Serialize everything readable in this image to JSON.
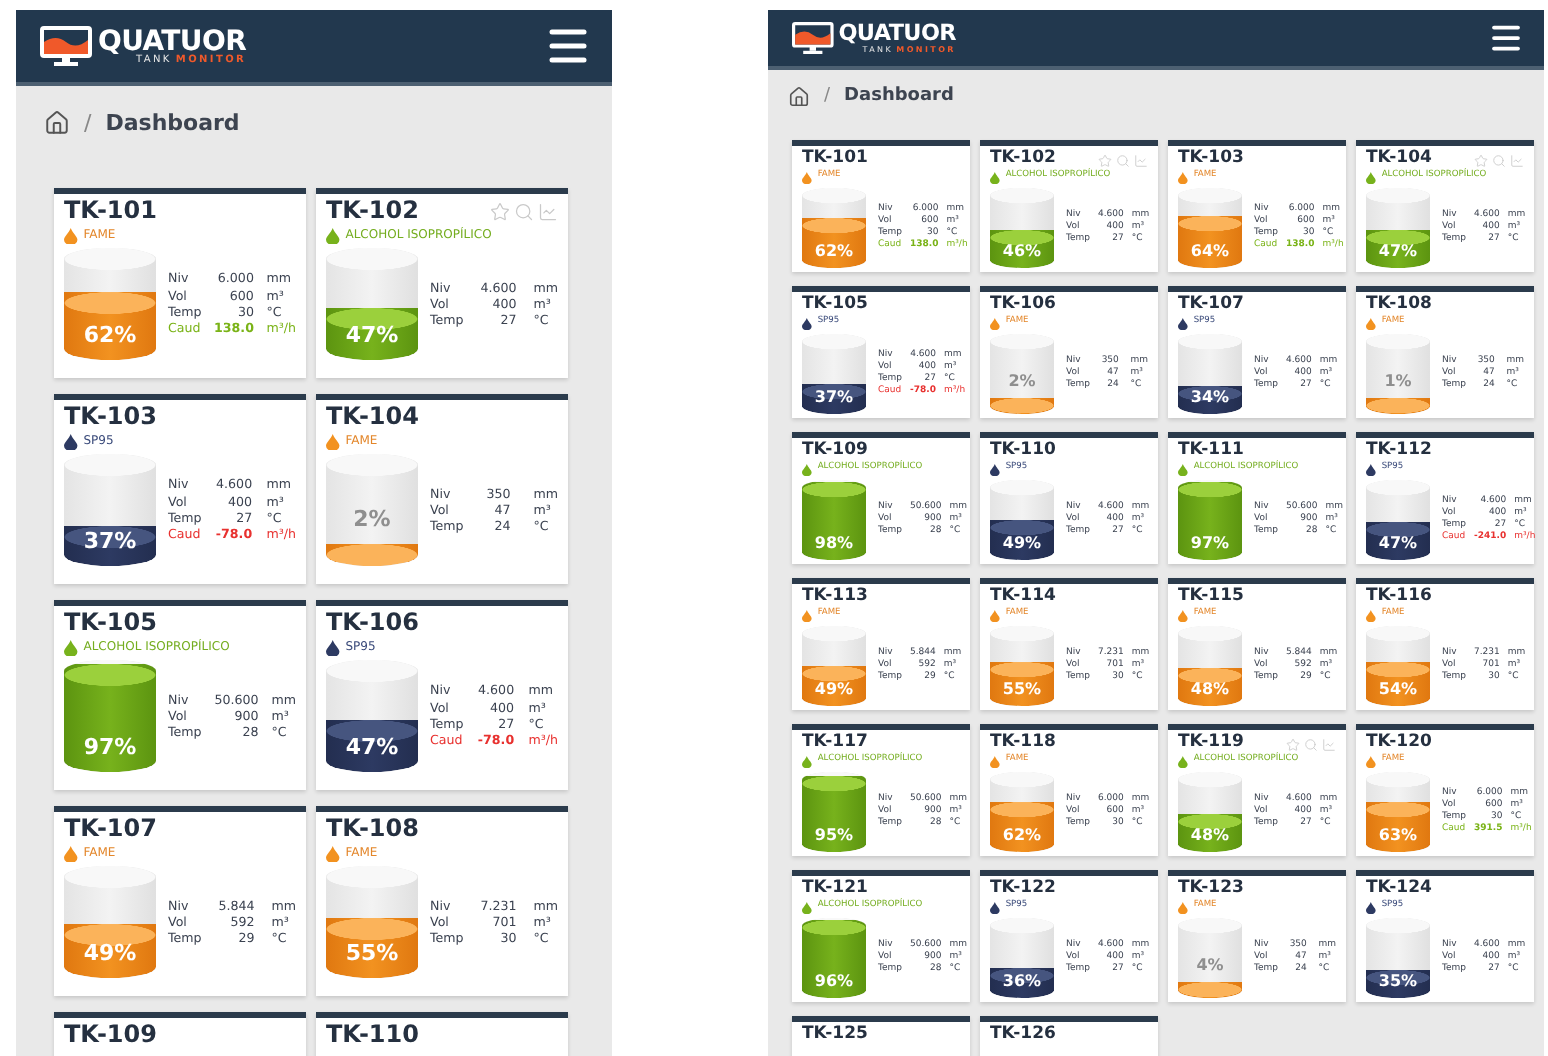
{
  "screens": [
    {
      "brand": {
        "name": "QUATUOR",
        "tagline_1": "TANK",
        "tagline_2": "MONITOR"
      },
      "breadcrumb": {
        "separator": "/",
        "current": "Dashboard"
      },
      "tanks": [
        {
          "name": "TK-101",
          "actions_shown": false,
          "product": {
            "kind": "fame",
            "label": "FAME"
          },
          "level": 0.62,
          "percent": "62%",
          "readings": [
            {
              "label": "Niv",
              "value": "6.000",
              "unit": "mm",
              "kind": "normal"
            },
            {
              "label": "Vol",
              "value": "600",
              "unit": "m³",
              "kind": "normal"
            },
            {
              "label": "Temp",
              "value": "30",
              "unit": "°C",
              "kind": "normal"
            },
            {
              "label": "Caud",
              "value": "138.0",
              "unit": "m³/h",
              "kind": "positive"
            }
          ]
        },
        {
          "name": "TK-102",
          "actions_shown": true,
          "product": {
            "kind": "alcohol",
            "label": "ALCOHOL ISOPROPÍLICO"
          },
          "level": 0.47,
          "percent": "47%",
          "readings": [
            {
              "label": "Niv",
              "value": "4.600",
              "unit": "mm",
              "kind": "normal"
            },
            {
              "label": "Vol",
              "value": "400",
              "unit": "m³",
              "kind": "normal"
            },
            {
              "label": "Temp",
              "value": "27",
              "unit": "°C",
              "kind": "normal"
            }
          ]
        },
        {
          "name": "TK-103",
          "actions_shown": false,
          "product": {
            "kind": "sp95",
            "label": "SP95"
          },
          "level": 0.37,
          "percent": "37%",
          "readings": [
            {
              "label": "Niv",
              "value": "4.600",
              "unit": "mm",
              "kind": "normal"
            },
            {
              "label": "Vol",
              "value": "400",
              "unit": "m³",
              "kind": "normal"
            },
            {
              "label": "Temp",
              "value": "27",
              "unit": "°C",
              "kind": "normal"
            },
            {
              "label": "Caud",
              "value": "-78.0",
              "unit": "m³/h",
              "kind": "negative"
            }
          ]
        },
        {
          "name": "TK-104",
          "actions_shown": false,
          "product": {
            "kind": "fame",
            "label": "FAME"
          },
          "level": 0.02,
          "percent": "2%",
          "readings": [
            {
              "label": "Niv",
              "value": "350",
              "unit": "mm",
              "kind": "normal"
            },
            {
              "label": "Vol",
              "value": "47",
              "unit": "m³",
              "kind": "normal"
            },
            {
              "label": "Temp",
              "value": "24",
              "unit": "°C",
              "kind": "normal"
            }
          ]
        },
        {
          "name": "TK-105",
          "actions_shown": false,
          "product": {
            "kind": "alcohol",
            "label": "ALCOHOL ISOPROPÍLICO"
          },
          "level": 0.97,
          "percent": "97%",
          "readings": [
            {
              "label": "Niv",
              "value": "50.600",
              "unit": "mm",
              "kind": "normal"
            },
            {
              "label": "Vol",
              "value": "900",
              "unit": "m³",
              "kind": "normal"
            },
            {
              "label": "Temp",
              "value": "28",
              "unit": "°C",
              "kind": "normal"
            }
          ]
        },
        {
          "name": "TK-106",
          "actions_shown": false,
          "product": {
            "kind": "sp95",
            "label": "SP95"
          },
          "level": 0.47,
          "percent": "47%",
          "readings": [
            {
              "label": "Niv",
              "value": "4.600",
              "unit": "mm",
              "kind": "normal"
            },
            {
              "label": "Vol",
              "value": "400",
              "unit": "m³",
              "kind": "normal"
            },
            {
              "label": "Temp",
              "value": "27",
              "unit": "°C",
              "kind": "normal"
            },
            {
              "label": "Caud",
              "value": "-78.0",
              "unit": "m³/h",
              "kind": "negative"
            }
          ]
        },
        {
          "name": "TK-107",
          "actions_shown": false,
          "product": {
            "kind": "fame",
            "label": "FAME"
          },
          "level": 0.49,
          "percent": "49%",
          "readings": [
            {
              "label": "Niv",
              "value": "5.844",
              "unit": "mm",
              "kind": "normal"
            },
            {
              "label": "Vol",
              "value": "592",
              "unit": "m³",
              "kind": "normal"
            },
            {
              "label": "Temp",
              "value": "29",
              "unit": "°C",
              "kind": "normal"
            }
          ]
        },
        {
          "name": "TK-108",
          "actions_shown": false,
          "product": {
            "kind": "fame",
            "label": "FAME"
          },
          "level": 0.55,
          "percent": "55%",
          "readings": [
            {
              "label": "Niv",
              "value": "7.231",
              "unit": "mm",
              "kind": "normal"
            },
            {
              "label": "Vol",
              "value": "701",
              "unit": "m³",
              "kind": "normal"
            },
            {
              "label": "Temp",
              "value": "30",
              "unit": "°C",
              "kind": "normal"
            }
          ]
        },
        {
          "name": "TK-109",
          "actions_shown": false
        },
        {
          "name": "TK-110",
          "actions_shown": false
        }
      ]
    },
    {
      "brand": {
        "name": "QUATUOR",
        "tagline_1": "TANK",
        "tagline_2": "MONITOR"
      },
      "breadcrumb": {
        "separator": "/",
        "current": "Dashboard"
      },
      "tanks": [
        {
          "name": "TK-101",
          "actions_shown": false,
          "product": {
            "kind": "fame",
            "label": "FAME"
          },
          "level": 0.62,
          "percent": "62%",
          "readings": [
            {
              "label": "Niv",
              "value": "6.000",
              "unit": "mm",
              "kind": "normal"
            },
            {
              "label": "Vol",
              "value": "600",
              "unit": "m³",
              "kind": "normal"
            },
            {
              "label": "Temp",
              "value": "30",
              "unit": "°C",
              "kind": "normal"
            },
            {
              "label": "Caud",
              "value": "138.0",
              "unit": "m³/h",
              "kind": "positive"
            }
          ]
        },
        {
          "name": "TK-102",
          "actions_shown": true,
          "product": {
            "kind": "alcohol",
            "label": "ALCOHOL ISOPROPÍLICO"
          },
          "level": 0.46,
          "percent": "46%",
          "readings": [
            {
              "label": "Niv",
              "value": "4.600",
              "unit": "mm",
              "kind": "normal"
            },
            {
              "label": "Vol",
              "value": "400",
              "unit": "m³",
              "kind": "normal"
            },
            {
              "label": "Temp",
              "value": "27",
              "unit": "°C",
              "kind": "normal"
            }
          ]
        },
        {
          "name": "TK-103",
          "actions_shown": false,
          "product": {
            "kind": "fame",
            "label": "FAME"
          },
          "level": 0.64,
          "percent": "64%",
          "readings": [
            {
              "label": "Niv",
              "value": "6.000",
              "unit": "mm",
              "kind": "normal"
            },
            {
              "label": "Vol",
              "value": "600",
              "unit": "m³",
              "kind": "normal"
            },
            {
              "label": "Temp",
              "value": "30",
              "unit": "°C",
              "kind": "normal"
            },
            {
              "label": "Caud",
              "value": "138.0",
              "unit": "m³/h",
              "kind": "positive"
            }
          ]
        },
        {
          "name": "TK-104",
          "actions_shown": true,
          "product": {
            "kind": "alcohol",
            "label": "ALCOHOL ISOPROPÍLICO"
          },
          "level": 0.47,
          "percent": "47%",
          "readings": [
            {
              "label": "Niv",
              "value": "4.600",
              "unit": "mm",
              "kind": "normal"
            },
            {
              "label": "Vol",
              "value": "400",
              "unit": "m³",
              "kind": "normal"
            },
            {
              "label": "Temp",
              "value": "27",
              "unit": "°C",
              "kind": "normal"
            }
          ]
        },
        {
          "name": "TK-105",
          "actions_shown": false,
          "product": {
            "kind": "sp95",
            "label": "SP95"
          },
          "level": 0.37,
          "percent": "37%",
          "readings": [
            {
              "label": "Niv",
              "value": "4.600",
              "unit": "mm",
              "kind": "normal"
            },
            {
              "label": "Vol",
              "value": "400",
              "unit": "m³",
              "kind": "normal"
            },
            {
              "label": "Temp",
              "value": "27",
              "unit": "°C",
              "kind": "normal"
            },
            {
              "label": "Caud",
              "value": "-78.0",
              "unit": "m³/h",
              "kind": "negative"
            }
          ]
        },
        {
          "name": "TK-106",
          "actions_shown": false,
          "product": {
            "kind": "fame",
            "label": "FAME"
          },
          "level": 0.02,
          "percent": "2%",
          "readings": [
            {
              "label": "Niv",
              "value": "350",
              "unit": "mm",
              "kind": "normal"
            },
            {
              "label": "Vol",
              "value": "47",
              "unit": "m³",
              "kind": "normal"
            },
            {
              "label": "Temp",
              "value": "24",
              "unit": "°C",
              "kind": "normal"
            }
          ]
        },
        {
          "name": "TK-107",
          "actions_shown": false,
          "product": {
            "kind": "sp95",
            "label": "SP95"
          },
          "level": 0.34,
          "percent": "34%",
          "readings": [
            {
              "label": "Niv",
              "value": "4.600",
              "unit": "mm",
              "kind": "normal"
            },
            {
              "label": "Vol",
              "value": "400",
              "unit": "m³",
              "kind": "normal"
            },
            {
              "label": "Temp",
              "value": "27",
              "unit": "°C",
              "kind": "normal"
            }
          ]
        },
        {
          "name": "TK-108",
          "actions_shown": false,
          "product": {
            "kind": "fame",
            "label": "FAME"
          },
          "level": 0.01,
          "percent": "1%",
          "readings": [
            {
              "label": "Niv",
              "value": "350",
              "unit": "mm",
              "kind": "normal"
            },
            {
              "label": "Vol",
              "value": "47",
              "unit": "m³",
              "kind": "normal"
            },
            {
              "label": "Temp",
              "value": "24",
              "unit": "°C",
              "kind": "normal"
            }
          ]
        },
        {
          "name": "TK-109",
          "actions_shown": false,
          "product": {
            "kind": "alcohol",
            "label": "ALCOHOL ISOPROPÍLICO"
          },
          "level": 0.98,
          "percent": "98%",
          "readings": [
            {
              "label": "Niv",
              "value": "50.600",
              "unit": "mm",
              "kind": "normal"
            },
            {
              "label": "Vol",
              "value": "900",
              "unit": "m³",
              "kind": "normal"
            },
            {
              "label": "Temp",
              "value": "28",
              "unit": "°C",
              "kind": "normal"
            }
          ]
        },
        {
          "name": "TK-110",
          "actions_shown": false,
          "product": {
            "kind": "sp95",
            "label": "SP95"
          },
          "level": 0.49,
          "percent": "49%",
          "readings": [
            {
              "label": "Niv",
              "value": "4.600",
              "unit": "mm",
              "kind": "normal"
            },
            {
              "label": "Vol",
              "value": "400",
              "unit": "m³",
              "kind": "normal"
            },
            {
              "label": "Temp",
              "value": "27",
              "unit": "°C",
              "kind": "normal"
            }
          ]
        },
        {
          "name": "TK-111",
          "actions_shown": false,
          "product": {
            "kind": "alcohol",
            "label": "ALCOHOL ISOPROPÍLICO"
          },
          "level": 0.97,
          "percent": "97%",
          "readings": [
            {
              "label": "Niv",
              "value": "50.600",
              "unit": "mm",
              "kind": "normal"
            },
            {
              "label": "Vol",
              "value": "900",
              "unit": "m³",
              "kind": "normal"
            },
            {
              "label": "Temp",
              "value": "28",
              "unit": "°C",
              "kind": "normal"
            }
          ]
        },
        {
          "name": "TK-112",
          "actions_shown": false,
          "product": {
            "kind": "sp95",
            "label": "SP95"
          },
          "level": 0.47,
          "percent": "47%",
          "readings": [
            {
              "label": "Niv",
              "value": "4.600",
              "unit": "mm",
              "kind": "normal"
            },
            {
              "label": "Vol",
              "value": "400",
              "unit": "m³",
              "kind": "normal"
            },
            {
              "label": "Temp",
              "value": "27",
              "unit": "°C",
              "kind": "normal"
            },
            {
              "label": "Caud",
              "value": "-241.0",
              "unit": "m³/h",
              "kind": "negative"
            }
          ]
        },
        {
          "name": "TK-113",
          "actions_shown": false,
          "product": {
            "kind": "fame",
            "label": "FAME"
          },
          "level": 0.49,
          "percent": "49%",
          "readings": [
            {
              "label": "Niv",
              "value": "5.844",
              "unit": "mm",
              "kind": "normal"
            },
            {
              "label": "Vol",
              "value": "592",
              "unit": "m³",
              "kind": "normal"
            },
            {
              "label": "Temp",
              "value": "29",
              "unit": "°C",
              "kind": "normal"
            }
          ]
        },
        {
          "name": "TK-114",
          "actions_shown": false,
          "product": {
            "kind": "fame",
            "label": "FAME"
          },
          "level": 0.55,
          "percent": "55%",
          "readings": [
            {
              "label": "Niv",
              "value": "7.231",
              "unit": "mm",
              "kind": "normal"
            },
            {
              "label": "Vol",
              "value": "701",
              "unit": "m³",
              "kind": "normal"
            },
            {
              "label": "Temp",
              "value": "30",
              "unit": "°C",
              "kind": "normal"
            }
          ]
        },
        {
          "name": "TK-115",
          "actions_shown": false,
          "product": {
            "kind": "fame",
            "label": "FAME"
          },
          "level": 0.48,
          "percent": "48%",
          "readings": [
            {
              "label": "Niv",
              "value": "5.844",
              "unit": "mm",
              "kind": "normal"
            },
            {
              "label": "Vol",
              "value": "592",
              "unit": "m³",
              "kind": "normal"
            },
            {
              "label": "Temp",
              "value": "29",
              "unit": "°C",
              "kind": "normal"
            }
          ]
        },
        {
          "name": "TK-116",
          "actions_shown": false,
          "product": {
            "kind": "fame",
            "label": "FAME"
          },
          "level": 0.54,
          "percent": "54%",
          "readings": [
            {
              "label": "Niv",
              "value": "7.231",
              "unit": "mm",
              "kind": "normal"
            },
            {
              "label": "Vol",
              "value": "701",
              "unit": "m³",
              "kind": "normal"
            },
            {
              "label": "Temp",
              "value": "30",
              "unit": "°C",
              "kind": "normal"
            }
          ]
        },
        {
          "name": "TK-117",
          "actions_shown": false,
          "product": {
            "kind": "alcohol",
            "label": "ALCOHOL ISOPROPÍLICO"
          },
          "level": 0.95,
          "percent": "95%",
          "readings": [
            {
              "label": "Niv",
              "value": "50.600",
              "unit": "mm",
              "kind": "normal"
            },
            {
              "label": "Vol",
              "value": "900",
              "unit": "m³",
              "kind": "normal"
            },
            {
              "label": "Temp",
              "value": "28",
              "unit": "°C",
              "kind": "normal"
            }
          ]
        },
        {
          "name": "TK-118",
          "actions_shown": false,
          "product": {
            "kind": "fame",
            "label": "FAME"
          },
          "level": 0.62,
          "percent": "62%",
          "readings": [
            {
              "label": "Niv",
              "value": "6.000",
              "unit": "mm",
              "kind": "normal"
            },
            {
              "label": "Vol",
              "value": "600",
              "unit": "m³",
              "kind": "normal"
            },
            {
              "label": "Temp",
              "value": "30",
              "unit": "°C",
              "kind": "normal"
            }
          ]
        },
        {
          "name": "TK-119",
          "actions_shown": true,
          "product": {
            "kind": "alcohol",
            "label": "ALCOHOL ISOPROPÍLICO"
          },
          "level": 0.48,
          "percent": "48%",
          "readings": [
            {
              "label": "Niv",
              "value": "4.600",
              "unit": "mm",
              "kind": "normal"
            },
            {
              "label": "Vol",
              "value": "400",
              "unit": "m³",
              "kind": "normal"
            },
            {
              "label": "Temp",
              "value": "27",
              "unit": "°C",
              "kind": "normal"
            }
          ]
        },
        {
          "name": "TK-120",
          "actions_shown": false,
          "product": {
            "kind": "fame",
            "label": "FAME"
          },
          "level": 0.63,
          "percent": "63%",
          "readings": [
            {
              "label": "Niv",
              "value": "6.000",
              "unit": "mm",
              "kind": "normal"
            },
            {
              "label": "Vol",
              "value": "600",
              "unit": "m³",
              "kind": "normal"
            },
            {
              "label": "Temp",
              "value": "30",
              "unit": "°C",
              "kind": "normal"
            },
            {
              "label": "Caud",
              "value": "391.5",
              "unit": "m³/h",
              "kind": "positive"
            }
          ]
        },
        {
          "name": "TK-121",
          "actions_shown": false,
          "product": {
            "kind": "alcohol",
            "label": "ALCOHOL ISOPROPÍLICO"
          },
          "level": 0.96,
          "percent": "96%",
          "readings": [
            {
              "label": "Niv",
              "value": "50.600",
              "unit": "mm",
              "kind": "normal"
            },
            {
              "label": "Vol",
              "value": "900",
              "unit": "m³",
              "kind": "normal"
            },
            {
              "label": "Temp",
              "value": "28",
              "unit": "°C",
              "kind": "normal"
            }
          ]
        },
        {
          "name": "TK-122",
          "actions_shown": false,
          "product": {
            "kind": "sp95",
            "label": "SP95"
          },
          "level": 0.36,
          "percent": "36%",
          "readings": [
            {
              "label": "Niv",
              "value": "4.600",
              "unit": "mm",
              "kind": "normal"
            },
            {
              "label": "Vol",
              "value": "400",
              "unit": "m³",
              "kind": "normal"
            },
            {
              "label": "Temp",
              "value": "27",
              "unit": "°C",
              "kind": "normal"
            }
          ]
        },
        {
          "name": "TK-123",
          "actions_shown": false,
          "product": {
            "kind": "fame",
            "label": "FAME"
          },
          "level": 0.04,
          "percent": "4%",
          "readings": [
            {
              "label": "Niv",
              "value": "350",
              "unit": "mm",
              "kind": "normal"
            },
            {
              "label": "Vol",
              "value": "47",
              "unit": "m³",
              "kind": "normal"
            },
            {
              "label": "Temp",
              "value": "24",
              "unit": "°C",
              "kind": "normal"
            }
          ]
        },
        {
          "name": "TK-124",
          "actions_shown": false,
          "product": {
            "kind": "sp95",
            "label": "SP95"
          },
          "level": 0.35,
          "percent": "35%",
          "readings": [
            {
              "label": "Niv",
              "value": "4.600",
              "unit": "mm",
              "kind": "normal"
            },
            {
              "label": "Vol",
              "value": "400",
              "unit": "m³",
              "kind": "normal"
            },
            {
              "label": "Temp",
              "value": "27",
              "unit": "°C",
              "kind": "normal"
            }
          ]
        },
        {
          "name": "TK-125",
          "actions_shown": false
        },
        {
          "name": "TK-126",
          "actions_shown": false
        }
      ]
    }
  ]
}
